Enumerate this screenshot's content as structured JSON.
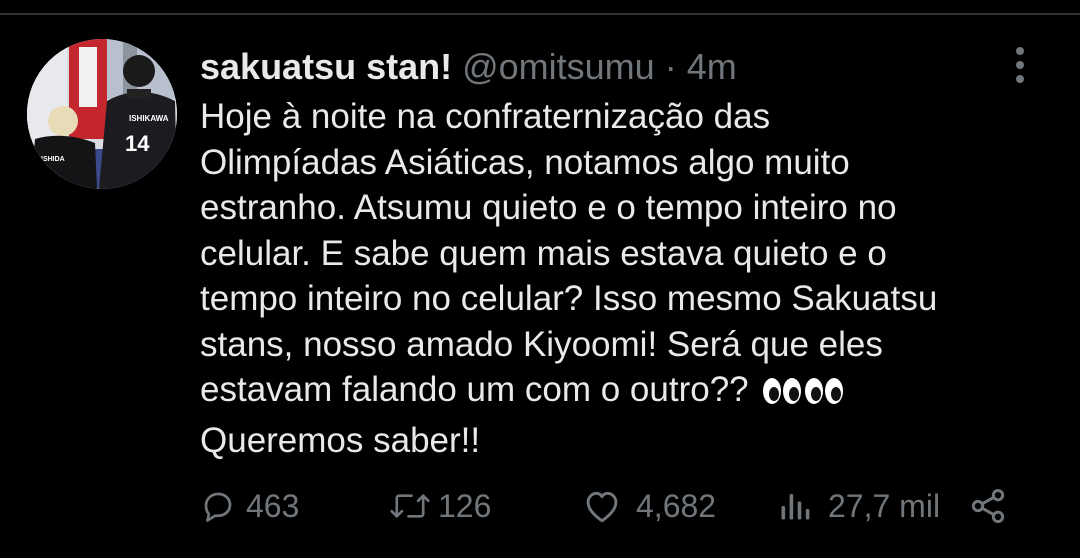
{
  "tweet": {
    "display_name": "sakuatsu stan!",
    "handle": "@omitsumu",
    "separator": "·",
    "time": "4m",
    "text_lines": [
      "Hoje à noite na confraternização das",
      "Olimpíadas Asiáticas, notamos algo muito",
      "estranho. Atsumu quieto e o tempo inteiro no",
      "celular. E sabe quem mais estava quieto e o",
      "tempo inteiro no celular? Isso mesmo Sakuatsu",
      "stans, nosso amado Kiyoomi! Será que eles",
      "estavam falando um com o outro?? ",
      "Queremos saber!!"
    ],
    "avatar": {
      "jersey_name": "ISHIKAWA",
      "jersey_number": "14",
      "second_jersey_name": "ISHIDA"
    }
  },
  "actions": {
    "replies": "463",
    "retweets": "126",
    "likes": "4,682",
    "views": "27,7 mil"
  },
  "icons": {
    "reply": "reply-icon",
    "retweet": "retweet-icon",
    "like": "heart-icon",
    "views": "views-icon",
    "share": "share-icon",
    "more": "more-icon",
    "emoji": "eyes-emoji-icon"
  },
  "colors": {
    "background": "#000000",
    "primary_text": "#e7e9ea",
    "secondary_text": "#71767b",
    "divider": "#2f3336"
  }
}
